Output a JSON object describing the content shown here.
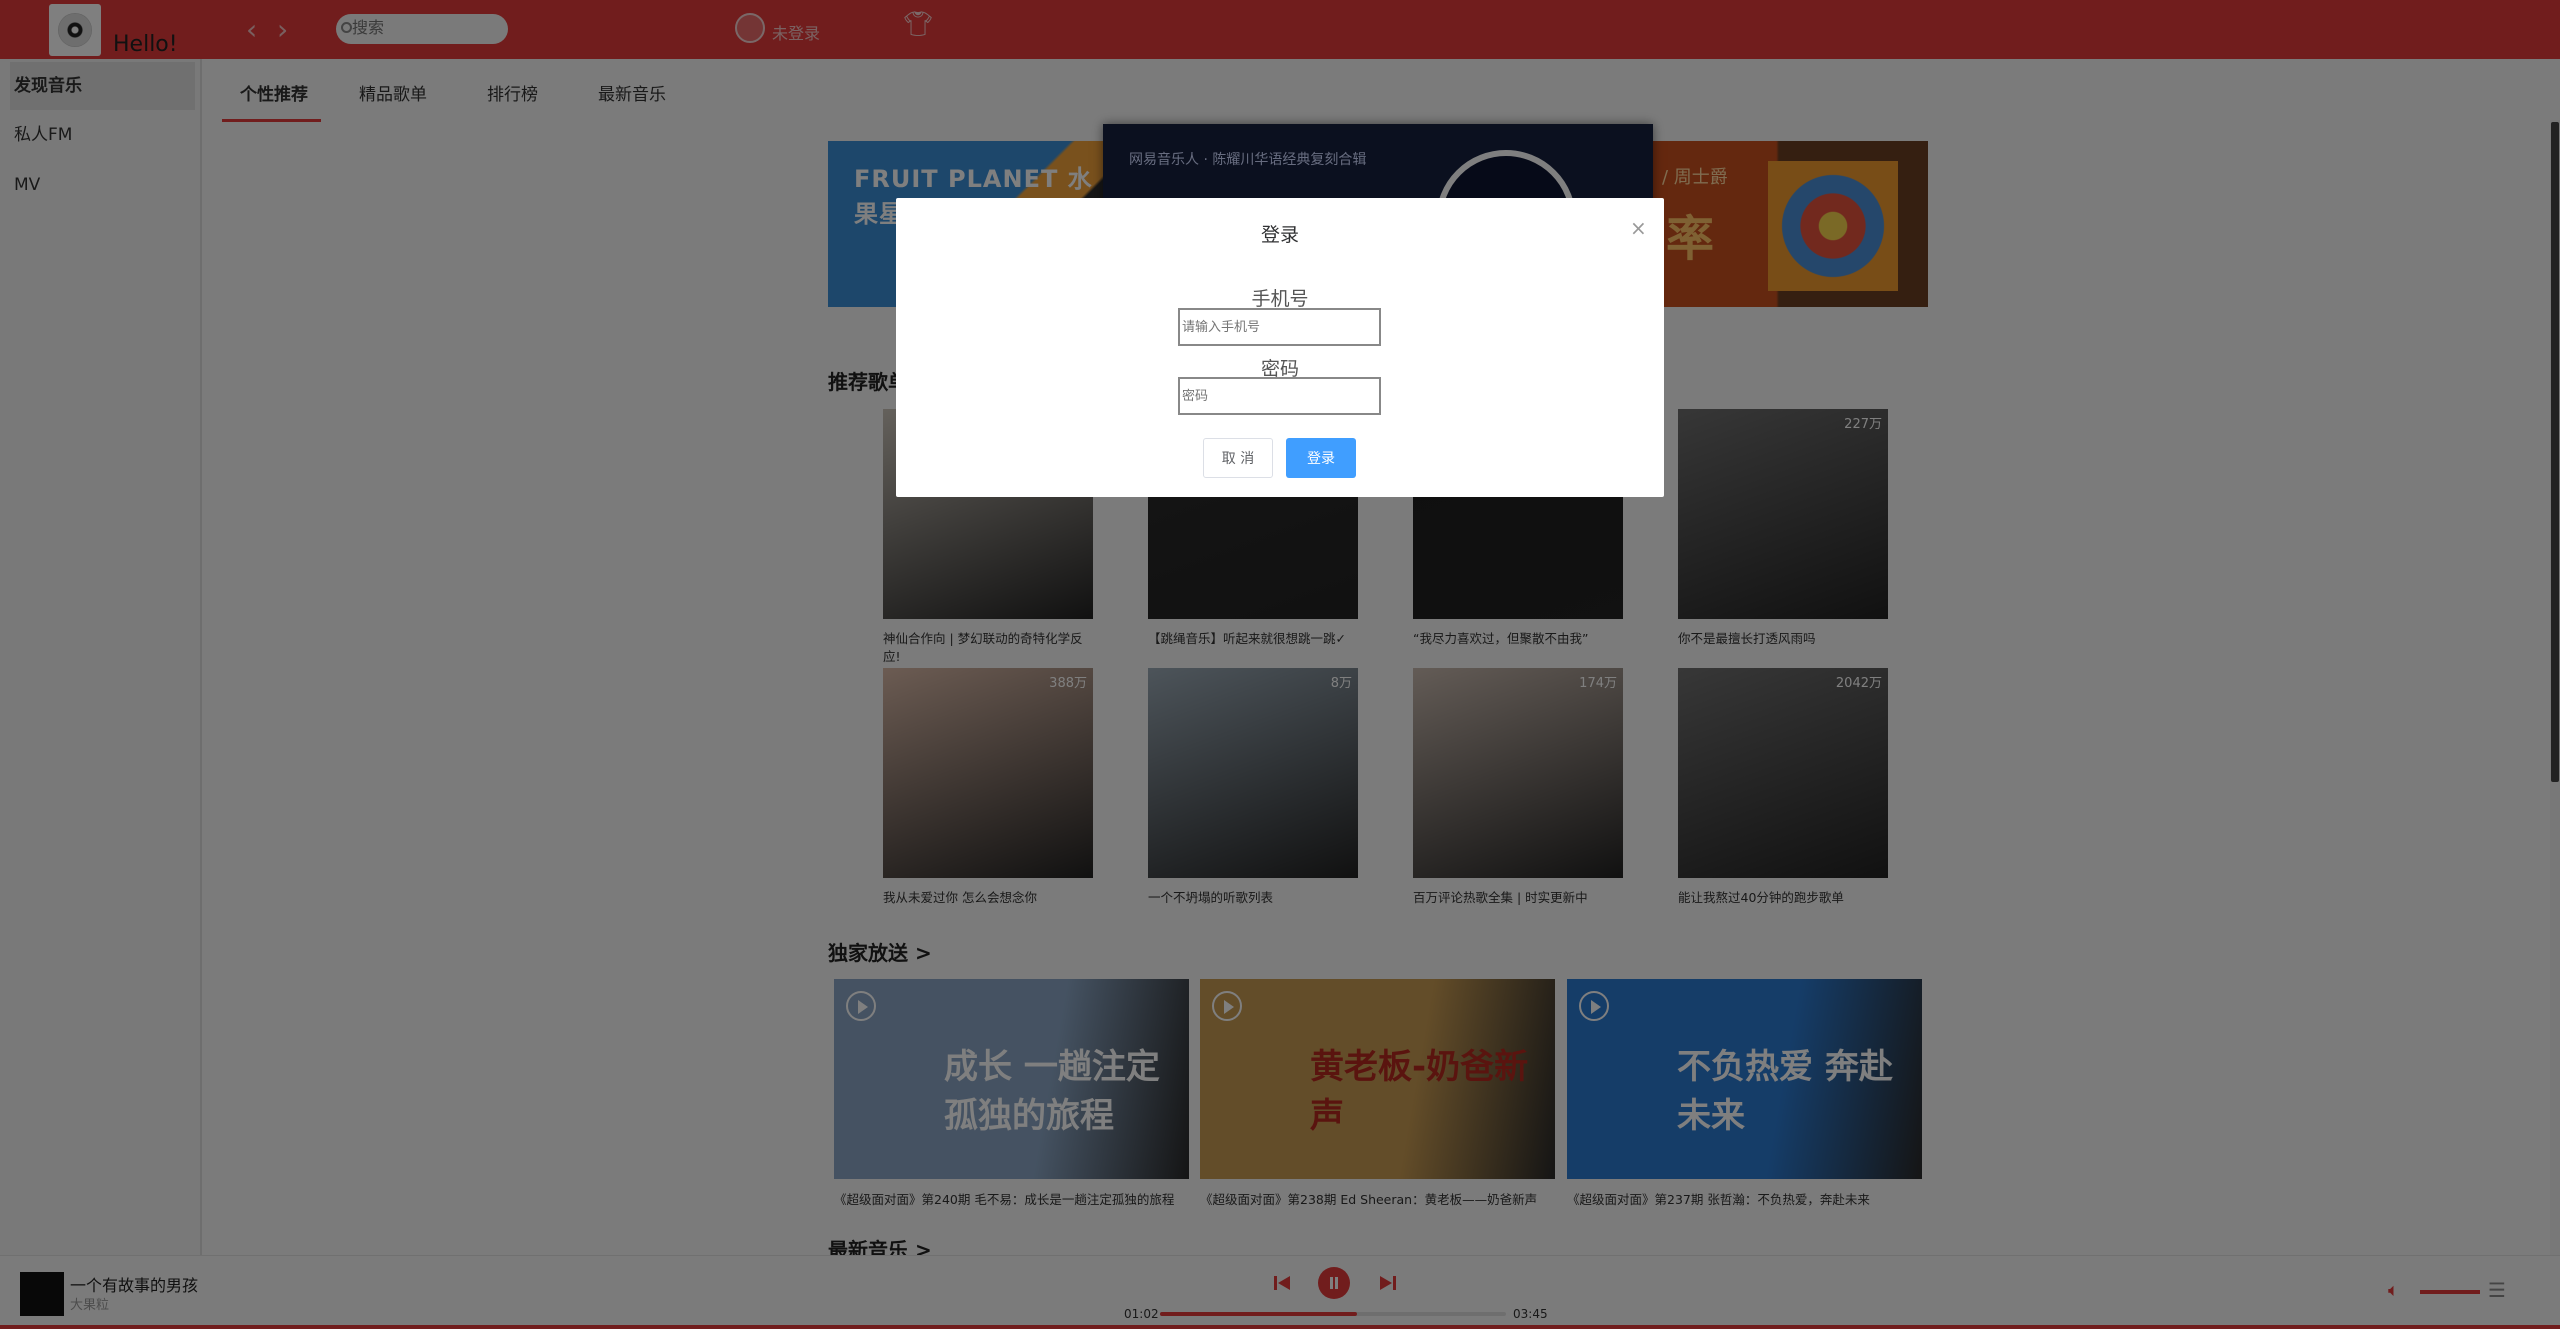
{
  "header": {
    "greeting": "Hello!",
    "search_placeholder": "搜索",
    "login_status": "未登录",
    "back_glyph": "‹",
    "forward_glyph": "›"
  },
  "sidebar": {
    "items": [
      {
        "label": "发现音乐",
        "active": true
      },
      {
        "label": "私人FM",
        "active": false
      },
      {
        "label": "MV",
        "active": false
      }
    ]
  },
  "tabs": [
    {
      "label": "个性推荐",
      "active": true
    },
    {
      "label": "精品歌单",
      "active": false
    },
    {
      "label": "排行榜",
      "active": false
    },
    {
      "label": "最新音乐",
      "active": false
    }
  ],
  "banner": {
    "left_text": "FRUIT PLANET 水果星球",
    "center_text": "网易音乐人 · 陈耀川华语经典复刻合辑",
    "right_text": "/ 周士爵",
    "right_big": "率"
  },
  "sections": {
    "recommended": "推荐歌单",
    "exclusive": "独家放送 >",
    "newest": "最新音乐 >"
  },
  "playlists": [
    {
      "title": "神仙合作向 | 梦幻联动的奇特化学反应!",
      "plays": "",
      "color": "#c9c2b8"
    },
    {
      "title": "【跳绳音乐】听起来就很想跳一跳✓",
      "plays": "",
      "color": "#2b2b2b"
    },
    {
      "title": "“我尽力喜欢过，但聚散不由我”",
      "plays": "",
      "color": "#1e1e1e"
    },
    {
      "title": "你不是最擅长打透风雨吗",
      "plays": "227万",
      "color": "#6e6e6e"
    },
    {
      "title": "我从未爱过你 怎么会想念你",
      "plays": "388万",
      "color": "#d8b8a6"
    },
    {
      "title": "一个不坍塌的听歌列表",
      "plays": "8万",
      "color": "#9aa9b5"
    },
    {
      "title": "百万评论热歌全集 | 时实更新中",
      "plays": "174万",
      "color": "#c7b8ad"
    },
    {
      "title": "能让我熬过40分钟的跑步歌单",
      "plays": "2042万",
      "color": "#6f6f6f"
    }
  ],
  "exclusives": [
    {
      "title": "《超级面对面》第240期 毛不易：成长是一趟注定孤独的旅程",
      "big": "成长 一趟注定孤独的旅程",
      "color": "#8aa5c4"
    },
    {
      "title": "《超级面对面》第238期 Ed Sheeran：黄老板——奶爸新声",
      "big": "黄老板-奶爸新声",
      "color": "#c79a52"
    },
    {
      "title": "《超级面对面》第237期 张哲瀚：不负热爱，奔赴未来",
      "big": "不负热爱 奔赴未来",
      "color": "#2b7ad1"
    }
  ],
  "dialog": {
    "title": "登录",
    "phone_label": "手机号",
    "phone_placeholder": "请输入手机号",
    "password_label": "密码",
    "password_placeholder": "密码",
    "cancel_label": "取 消",
    "login_label": "登录",
    "close_glyph": "×"
  },
  "player": {
    "song_title": "一个有故事的男孩",
    "artist": "大果粒",
    "current_time": "01:02",
    "total_time": "03:45",
    "progress_percent": 57,
    "volume_percent": 100
  },
  "colors": {
    "brand": "#e33b3b",
    "primary_button": "#409eff"
  },
  "icons": {
    "search": "search-icon",
    "user": "user-avatar-icon",
    "skin": "shirt-icon",
    "close": "close-icon",
    "prev": "prev-track-icon",
    "pause": "pause-icon",
    "next": "next-track-icon",
    "volume": "volume-icon",
    "playlist": "playlist-icon"
  }
}
